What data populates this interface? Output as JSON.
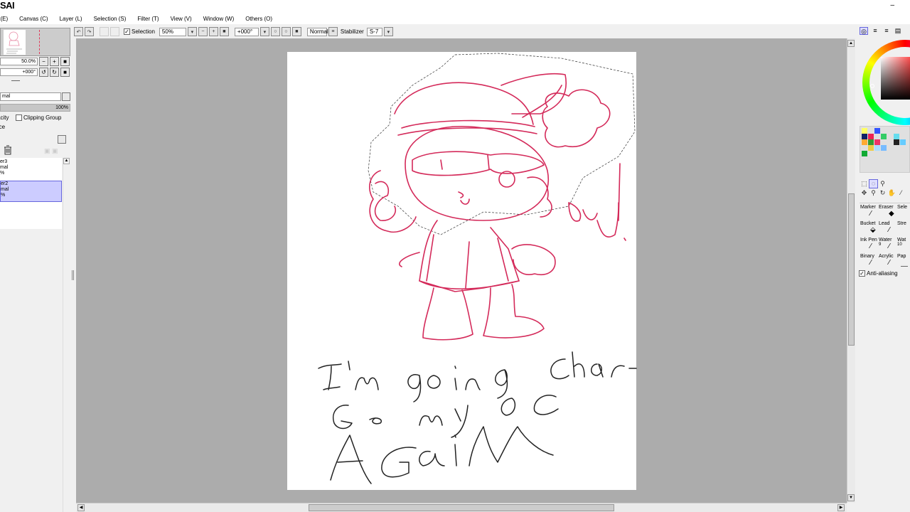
{
  "app": {
    "title": "SAI",
    "minimize_glyph": "–"
  },
  "menu": [
    {
      "label": "t (E)",
      "name": "menu-edit"
    },
    {
      "label": "Canvas (C)",
      "name": "menu-canvas"
    },
    {
      "label": "Layer (L)",
      "name": "menu-layer"
    },
    {
      "label": "Selection (S)",
      "name": "menu-selection"
    },
    {
      "label": "Filter (T)",
      "name": "menu-filter"
    },
    {
      "label": "View (V)",
      "name": "menu-view"
    },
    {
      "label": "Window (W)",
      "name": "menu-window"
    },
    {
      "label": "Others (O)",
      "name": "menu-others"
    }
  ],
  "toolbar": {
    "selection_label": "Selection",
    "selection_checked": "✓",
    "zoom": "50%",
    "rotation": "+000°",
    "blend_mode": "Normal",
    "stabilizer_label": "Stabilizer",
    "stabilizer_value": "S-7"
  },
  "navigator": {
    "zoom": "50.0%",
    "rotation": "+000°"
  },
  "layer_panel": {
    "blend_mode": "mal",
    "opacity": "100%",
    "opacity_label": "acity",
    "clipping_group_label": "Clipping Group",
    "source_label": "rce",
    "layers": [
      {
        "name": "er3",
        "mode": "mal",
        "opacity": "%",
        "selected": false
      },
      {
        "name": "er2",
        "mode": "mal",
        "opacity": "%",
        "selected": true
      }
    ]
  },
  "colors": {
    "canvas_bg": "#acacac",
    "sketch_red": "#d42a5a",
    "ink_black": "#222222",
    "selected_layer": "#ccccff"
  },
  "canvas_text": {
    "line1": "I'm going chan-",
    "line2": "ge my OC",
    "line3": "AGAIN",
    "bye": "Bay!"
  },
  "right_panel": {
    "swatches": [
      "#ffff66",
      "#3355ff",
      "#112266",
      "#ee2255",
      "#33cc66",
      "#66ddee",
      "#ffaa33",
      "#339933",
      "#ee3366",
      "#222222",
      "#66ccff",
      "#eecc44",
      "#aaddff",
      "#11aa33",
      "#77bbff"
    ],
    "tools": [
      {
        "name": "Marker",
        "size": ""
      },
      {
        "name": "Eraser",
        "size": ""
      },
      {
        "name": "Sele",
        "size": ""
      },
      {
        "name": "Bucket",
        "size": ""
      },
      {
        "name": "Lead",
        "size": ""
      },
      {
        "name": "Stre",
        "size": ""
      },
      {
        "name": "Ink Pen",
        "size": ""
      },
      {
        "name": "Water",
        "size": "9"
      },
      {
        "name": "Wat",
        "size": "10"
      },
      {
        "name": "Binary",
        "size": ""
      },
      {
        "name": "Acrylic",
        "size": ""
      },
      {
        "name": "Pap",
        "size": ""
      }
    ],
    "anti_aliasing_label": "Anti-aliasing",
    "anti_aliasing_checked": "✓"
  }
}
